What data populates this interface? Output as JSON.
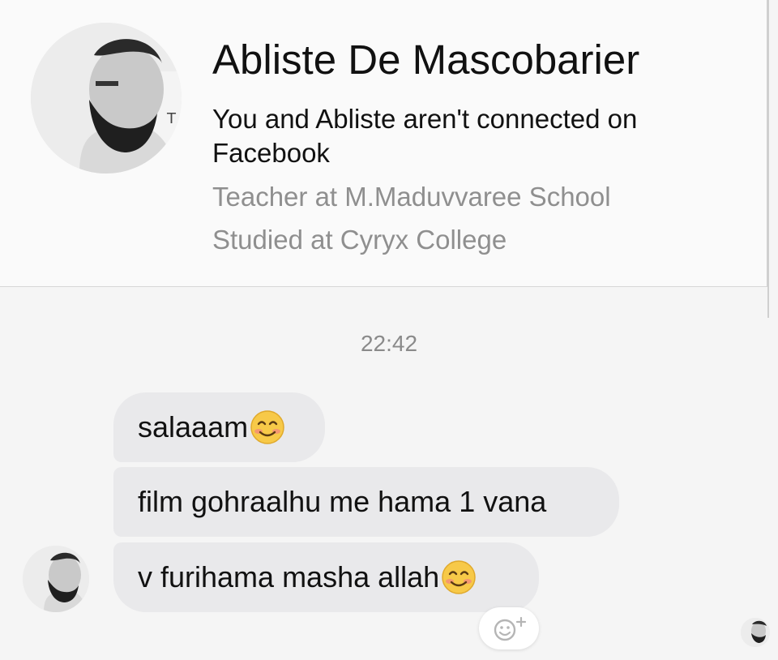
{
  "profile": {
    "name": "Abliste De Mascobarier",
    "connection_status": "You and Abliste aren't connected on Facebook",
    "work": "Teacher at M.Maduvvaree School",
    "education": "Studied at Cyryx College",
    "avatar_icon": "profile-photo"
  },
  "conversation": {
    "timestamp": "22:42",
    "messages": [
      {
        "text": "salaaam",
        "emoji": "smiling-face-icon"
      },
      {
        "text": "film gohraalhu me hama 1 vana",
        "emoji": ""
      },
      {
        "text": "v furihama masha allah",
        "emoji": "smiling-face-icon"
      }
    ],
    "react_button_icon": "add-reaction-icon",
    "seen_indicator_icon": "seen-avatar"
  },
  "colors": {
    "background": "#f5f5f5",
    "bubble": "#e9e9eb",
    "secondary_text": "#8f8f8f"
  }
}
